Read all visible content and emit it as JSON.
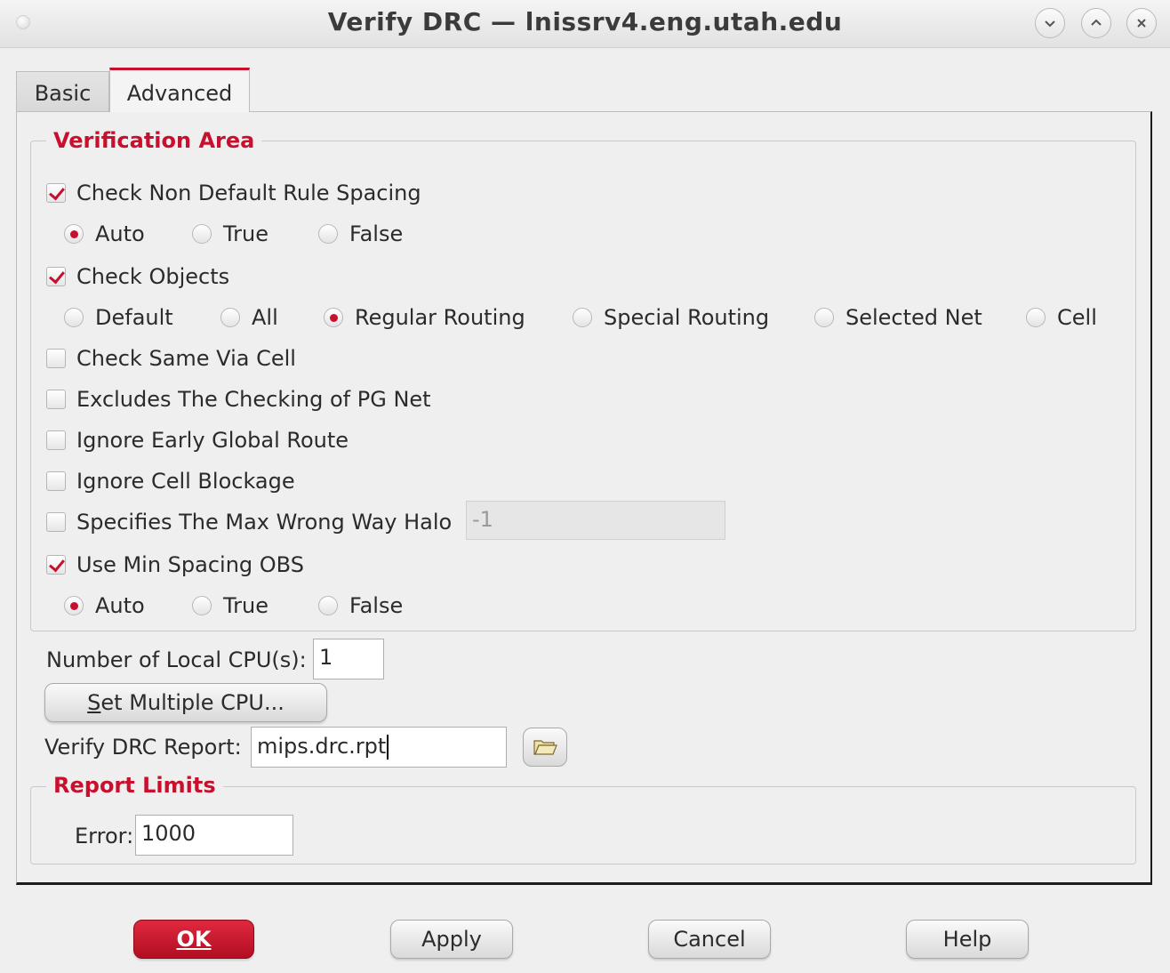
{
  "window": {
    "title": "Verify DRC — lnissrv4.eng.utah.edu",
    "controls": [
      "chevron-down-icon",
      "chevron-up-icon",
      "close-icon"
    ]
  },
  "tabs": [
    {
      "label": "Basic",
      "active": false
    },
    {
      "label": "Advanced",
      "active": true
    }
  ],
  "verification_area": {
    "legend": "Verification Area",
    "check_ndr_spacing": {
      "label": "Check Non Default Rule Spacing",
      "checked": true,
      "options": [
        {
          "label": "Auto",
          "selected": true
        },
        {
          "label": "True",
          "selected": false
        },
        {
          "label": "False",
          "selected": false
        }
      ]
    },
    "check_objects": {
      "label": "Check Objects",
      "checked": true,
      "options": [
        {
          "label": "Default",
          "selected": false
        },
        {
          "label": "All",
          "selected": false
        },
        {
          "label": "Regular Routing",
          "selected": true
        },
        {
          "label": "Special Routing",
          "selected": false
        },
        {
          "label": "Selected Net",
          "selected": false
        },
        {
          "label": "Cell",
          "selected": false
        }
      ]
    },
    "check_same_via_cell": {
      "label": "Check Same Via Cell",
      "checked": false
    },
    "exclude_pg_net": {
      "label": "Excludes The Checking of PG Net",
      "checked": false
    },
    "ignore_early_global_route": {
      "label": "Ignore Early Global Route",
      "checked": false
    },
    "ignore_cell_blockage": {
      "label": "Ignore Cell Blockage",
      "checked": false
    },
    "max_wrong_way_halo": {
      "label": "Specifies The Max Wrong Way Halo",
      "checked": false,
      "value": "-1"
    },
    "use_min_spacing_obs": {
      "label": "Use Min Spacing OBS",
      "checked": true,
      "options": [
        {
          "label": "Auto",
          "selected": true
        },
        {
          "label": "True",
          "selected": false
        },
        {
          "label": "False",
          "selected": false
        }
      ]
    }
  },
  "cpu": {
    "label": "Number of Local CPU(s):",
    "value": "1",
    "set_multiple_button": "Set Multiple CPU...",
    "mnemonic": "S"
  },
  "report": {
    "label": "Verify DRC Report:",
    "value": "mips.drc.rpt",
    "browse_icon": "folder-open-icon"
  },
  "report_limits": {
    "legend": "Report Limits",
    "error_label": "Error:",
    "error_value": "1000"
  },
  "buttons": {
    "ok": "OK",
    "apply": "Apply",
    "cancel": "Cancel",
    "help": "Help"
  },
  "colors": {
    "accent": "#c8102e",
    "background": "#efefef"
  }
}
